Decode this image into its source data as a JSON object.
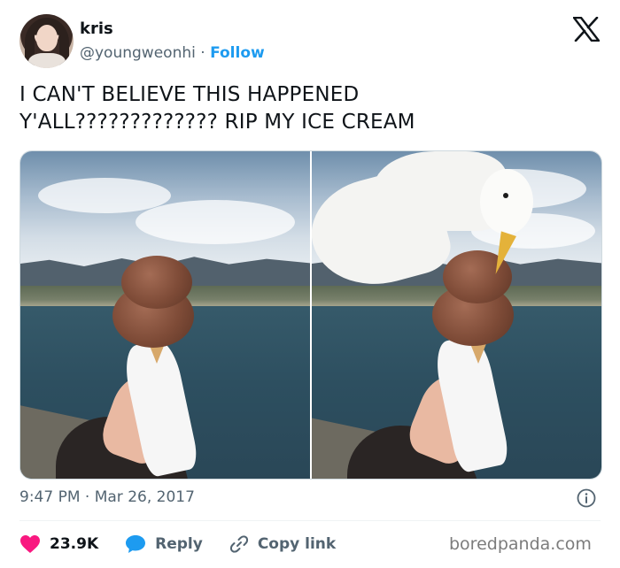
{
  "user": {
    "display_name": "kris",
    "handle": "@youngweonhi",
    "separator": "·",
    "follow_label": "Follow"
  },
  "tweet": {
    "text_line1": "I CAN'T BELIEVE THIS HAPPENED",
    "text_line2": "Y'ALL????????????? RIP MY ICE CREAM",
    "timestamp": "9:47 PM · Mar 26, 2017"
  },
  "media": {
    "photo_left": "Hand holding a chocolate ice cream cone over the sea",
    "photo_right": "Seagull biting the chocolate ice cream cone"
  },
  "actions": {
    "like_count": "23.9K",
    "reply_label": "Reply",
    "copy_link_label": "Copy link"
  },
  "credit": "boredpanda.com",
  "colors": {
    "accent": "#1d9bf0",
    "like": "#f91880",
    "text": "#0f1419",
    "muted": "#536471"
  },
  "icons": [
    "x-logo-icon",
    "info-icon",
    "heart-icon",
    "reply-bubble-icon",
    "link-icon"
  ]
}
